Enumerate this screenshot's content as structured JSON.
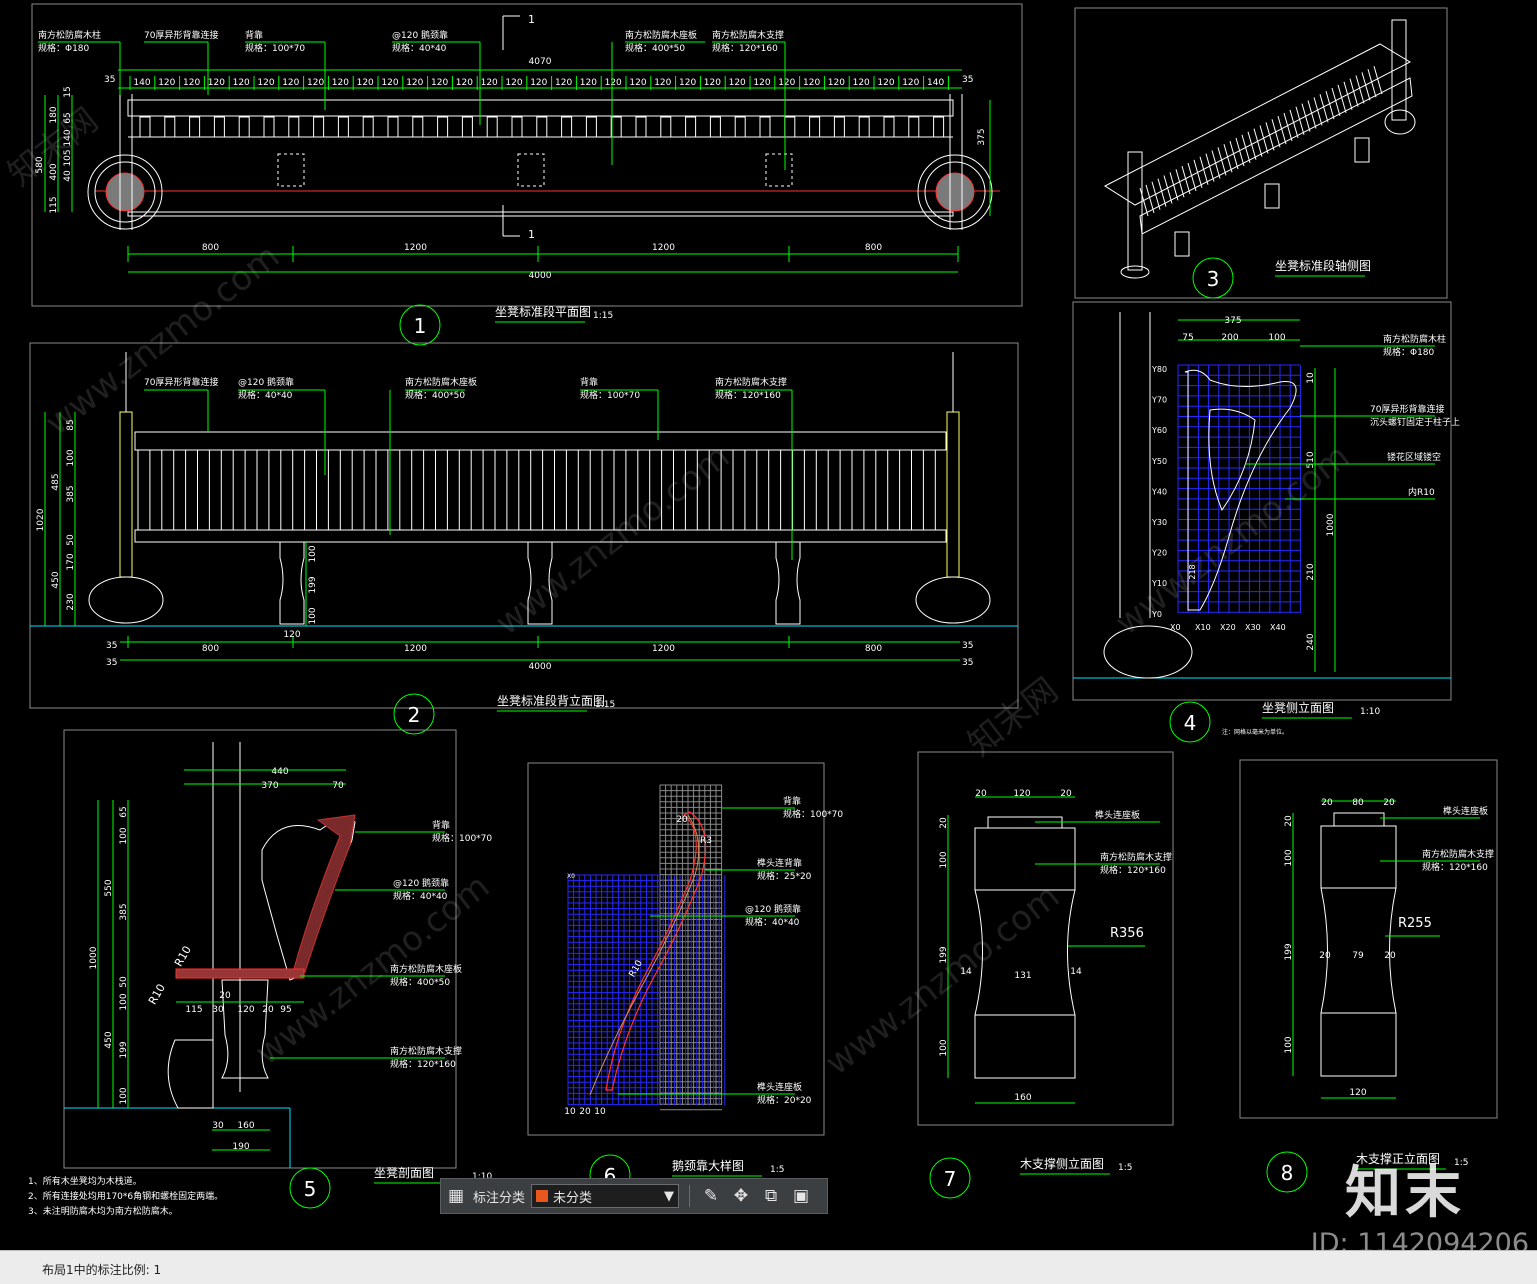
{
  "drawing": {
    "view_titles": [
      {
        "num": "1",
        "title": "坐凳标准段平面图",
        "scale": "1:15"
      },
      {
        "num": "2",
        "title": "坐凳标准段背立面图",
        "scale": "1:15"
      },
      {
        "num": "3",
        "title": "坐凳标准段轴侧图",
        "scale": ""
      },
      {
        "num": "4",
        "title": "坐凳侧立面图",
        "scale": "1:10"
      },
      {
        "num": "5",
        "title": "坐凳剖面图",
        "scale": "1:10"
      },
      {
        "num": "6",
        "title": "鹅颈靠大样图",
        "scale": "1:5"
      },
      {
        "num": "7",
        "title": "木支撑侧立面图",
        "scale": "1:5"
      },
      {
        "num": "8",
        "title": "木支撑正立面图",
        "scale": "1:5"
      }
    ],
    "plan_labels": [
      {
        "l1": "南方松防腐木柱",
        "l2": "规格：Φ180"
      },
      {
        "l1": "70厚异形背靠连接",
        "l2": ""
      },
      {
        "l1": "背靠",
        "l2": "规格：100*70"
      },
      {
        "l1": "@120  鹅颈靠",
        "l2": "规格：40*40"
      },
      {
        "l1": "南方松防腐木座板",
        "l2": "规格：400*50"
      },
      {
        "l1": "南方松防腐木支撑",
        "l2": "规格：120*160"
      }
    ],
    "plan_dims": {
      "top_total": "4070",
      "bottom_total": "4000",
      "spacing": "120",
      "end": "140",
      "edge": "35",
      "segments": [
        "800",
        "1200",
        "1200",
        "800"
      ],
      "left_vert": [
        "580",
        "180",
        "400",
        "115",
        "65",
        "15",
        "140",
        "105",
        "40"
      ],
      "right_vert": "375",
      "section": "1"
    },
    "elev_labels": [
      {
        "l1": "70厚异形背靠连接",
        "l2": ""
      },
      {
        "l1": "@120  鹅颈靠",
        "l2": "规格：40*40"
      },
      {
        "l1": "南方松防腐木座板",
        "l2": "规格：400*50"
      },
      {
        "l1": "背靠",
        "l2": "规格：100*70"
      },
      {
        "l1": "南方松防腐木支撑",
        "l2": "规格：120*160"
      }
    ],
    "elev_dims": {
      "total": "4000",
      "edge": "35",
      "segments": [
        "800",
        "1200",
        "1200",
        "800"
      ],
      "left_vert": [
        "1020",
        "485",
        "385",
        "50",
        "170",
        "450",
        "230",
        "100",
        "85"
      ],
      "post": [
        "100",
        "199",
        "100"
      ],
      "post_w": "120"
    },
    "side_labels": [
      {
        "l1": "南方松防腐木柱",
        "l2": "规格：Φ180"
      },
      {
        "l1": "70厚异形背靠连接",
        "l2": "沉头螺钉固定于柱子上"
      },
      {
        "l1": "镂花区域镂空",
        "l2": ""
      },
      {
        "l1": "内R10",
        "l2": ""
      }
    ],
    "side_dims": {
      "top": "375",
      "parts": [
        "75",
        "200",
        "100"
      ],
      "right": [
        "510",
        "1000",
        "210",
        "240",
        "10"
      ],
      "y_axis": [
        "Y80",
        "Y70",
        "Y60",
        "Y50",
        "Y40",
        "Y30",
        "Y20",
        "Y10",
        "Y0"
      ],
      "x_axis": [
        "X0",
        "X10",
        "X20",
        "X30",
        "X40"
      ],
      "left_small": "218",
      "note": "注：网格以毫米为单位。"
    },
    "section_labels": [
      {
        "l1": "背靠",
        "l2": "规格：100*70"
      },
      {
        "l1": "@120  鹅颈靠",
        "l2": "规格：40*40"
      },
      {
        "l1": "南方松防腐木座板",
        "l2": "规格：400*50"
      },
      {
        "l1": "南方松防腐木支撑",
        "l2": "规格：120*160"
      }
    ],
    "section_dims": {
      "top": "440",
      "parts": [
        "370",
        "70"
      ],
      "left": [
        "1000",
        "550",
        "385",
        "450",
        "100",
        "65",
        "50",
        "100",
        "199",
        "100"
      ],
      "bottom": [
        "115",
        "30",
        "120",
        "20",
        "95"
      ],
      "base": [
        "30",
        "160",
        "190"
      ],
      "r": "R10",
      "mid": "20"
    },
    "detail_labels": [
      {
        "l1": "背靠",
        "l2": "规格：100*70"
      },
      {
        "l1": "榫头连背靠",
        "l2": "规格：25*20"
      },
      {
        "l1": "@120  鹅颈靠",
        "l2": "规格：40*40"
      },
      {
        "l1": "榫头连座板",
        "l2": "规格：20*20"
      }
    ],
    "detail_dims": {
      "top": "20",
      "bottom": [
        "10",
        "20",
        "10"
      ],
      "r": "R3",
      "mid": "R10"
    },
    "support7": {
      "labels": [
        {
          "l1": "榫头连座板",
          "l2": ""
        },
        {
          "l1": "南方松防腐木支撑",
          "l2": "规格：120*160"
        }
      ],
      "top": [
        "20",
        "120",
        "20"
      ],
      "left": [
        "20",
        "100",
        "199",
        "100"
      ],
      "r": "R356",
      "neck": [
        "14",
        "131",
        "14"
      ],
      "bottom": "160"
    },
    "support8": {
      "labels": [
        {
          "l1": "榫头连座板",
          "l2": ""
        },
        {
          "l1": "南方松防腐木支撑",
          "l2": "规格：120*160"
        }
      ],
      "top": [
        "20",
        "80",
        "20"
      ],
      "left": [
        "20",
        "100",
        "199",
        "100"
      ],
      "r": "R255",
      "neck": [
        "20",
        "79",
        "20"
      ],
      "bottom": "120"
    },
    "notes": [
      "1、所有木坐凳均为木栈道。",
      "2、所有连接处均用170*6角钢和螺栓固定两端。",
      "3、未注明防腐木均为南方松防腐木。"
    ]
  },
  "watermarks": {
    "site": "www.znzmo.com",
    "brand_cn": "知末网",
    "brand": "知末",
    "id": "ID: 1142094206"
  },
  "toolbar": {
    "category_label": "标注分类",
    "category_value": "未分类",
    "swatch_color": "#e8571e",
    "icons": [
      "grid-icon",
      "edit-icon",
      "move-icon",
      "copy-icon",
      "paste-icon"
    ]
  },
  "status": {
    "text": "布局1中的标注比例: 1"
  },
  "colors": {
    "bg": "#000000",
    "white": "#ffffff",
    "green": "#00ff00",
    "cyan": "#00e5ff",
    "yellow": "#ffff66",
    "red": "#ff3030",
    "grid_blue": "#2828ff",
    "gray": "#8a8a8a"
  }
}
